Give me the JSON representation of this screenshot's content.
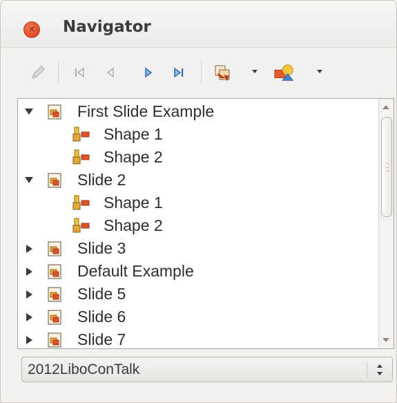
{
  "window": {
    "title": "Navigator",
    "close_symbol": "×"
  },
  "toolbar": {
    "items": [
      {
        "icon": "pen-icon",
        "enabled": false
      },
      {
        "icon": "first-slide-icon",
        "enabled": false
      },
      {
        "icon": "previous-slide-icon",
        "enabled": false
      },
      {
        "icon": "next-slide-icon",
        "enabled": true
      },
      {
        "icon": "last-slide-icon",
        "enabled": true
      },
      {
        "icon": "drag-mode-icon",
        "enabled": true
      },
      {
        "icon": "shapes-icon",
        "enabled": true
      }
    ]
  },
  "tree": {
    "items": [
      {
        "label": "First Slide Example",
        "type": "slide",
        "expanded": true
      },
      {
        "label": "Shape 1",
        "type": "shape"
      },
      {
        "label": "Shape 2",
        "type": "shape"
      },
      {
        "label": "Slide 2",
        "type": "slide",
        "expanded": true
      },
      {
        "label": "Shape 1",
        "type": "shape"
      },
      {
        "label": "Shape 2",
        "type": "shape"
      },
      {
        "label": "Slide 3",
        "type": "slide",
        "expanded": false
      },
      {
        "label": "Default Example",
        "type": "slide",
        "expanded": false
      },
      {
        "label": "Slide 5",
        "type": "slide",
        "expanded": false
      },
      {
        "label": "Slide 6",
        "type": "slide",
        "expanded": false
      },
      {
        "label": "Slide 7",
        "type": "slide",
        "expanded": false
      }
    ]
  },
  "document_select": {
    "value": "2012LiboConTalk"
  },
  "colors": {
    "close_button": "#e0512b",
    "active_arrow": "#2f6fb5",
    "disabled": "#b0aeab"
  }
}
